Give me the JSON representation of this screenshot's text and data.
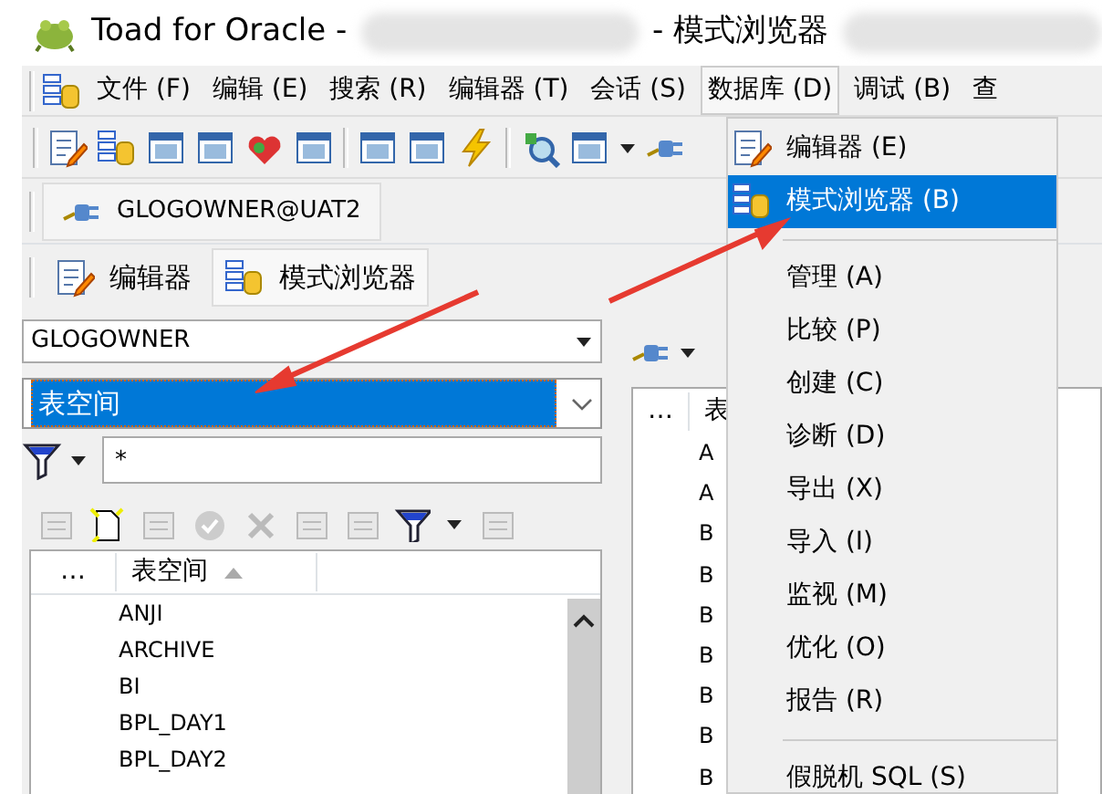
{
  "window": {
    "title_app": "Toad for Oracle -",
    "title_view": "- 模式浏览器"
  },
  "menu_bar": [
    {
      "label": "文件 (F)",
      "selected": false
    },
    {
      "label": "编辑 (E)",
      "selected": false
    },
    {
      "label": "搜索 (R)",
      "selected": false
    },
    {
      "label": "编辑器 (T)",
      "selected": false
    },
    {
      "label": "会话 (S)",
      "selected": false
    },
    {
      "label": "数据库 (D)",
      "selected": true
    },
    {
      "label": "调试 (B)",
      "selected": false
    },
    {
      "label": "查",
      "selected": false
    }
  ],
  "connection_tab": {
    "label": "GLOGOWNER@UAT2"
  },
  "editor_tabs": [
    {
      "label": "编辑器",
      "selected": false
    },
    {
      "label": "模式浏览器",
      "selected": true
    }
  ],
  "schema_dropdown": {
    "value": "GLOGOWNER"
  },
  "object_type_dropdown": {
    "value": "表空间"
  },
  "filter_field": {
    "value": "*"
  },
  "object_list": {
    "columns": [
      "…",
      "表空间"
    ],
    "rows": [
      "ANJI",
      "ARCHIVE",
      "BI",
      "BPL_DAY1",
      "BPL_DAY2"
    ]
  },
  "detail_list": {
    "columns": [
      "…",
      "表"
    ],
    "rows": [
      "A",
      "A",
      "B",
      "B",
      "B",
      "B",
      "B",
      "B",
      "B"
    ]
  },
  "database_menu": [
    {
      "kind": "item",
      "label": "编辑器 (E)",
      "selected": false
    },
    {
      "kind": "item",
      "label": "模式浏览器 (B)",
      "selected": true
    },
    {
      "kind": "separator"
    },
    {
      "kind": "item",
      "label": "管理 (A)",
      "selected": false
    },
    {
      "kind": "item",
      "label": "比较 (P)",
      "selected": false
    },
    {
      "kind": "item",
      "label": "创建 (C)",
      "selected": false
    },
    {
      "kind": "item",
      "label": "诊断 (D)",
      "selected": false
    },
    {
      "kind": "item",
      "label": "导出 (X)",
      "selected": false
    },
    {
      "kind": "item",
      "label": "导入 (I)",
      "selected": false
    },
    {
      "kind": "item",
      "label": "监视 (M)",
      "selected": false
    },
    {
      "kind": "item",
      "label": "优化 (O)",
      "selected": false
    },
    {
      "kind": "item",
      "label": "报告 (R)",
      "selected": false
    },
    {
      "kind": "separator"
    },
    {
      "kind": "item",
      "label": "假脱机 SQL (S)",
      "selected": false
    }
  ]
}
